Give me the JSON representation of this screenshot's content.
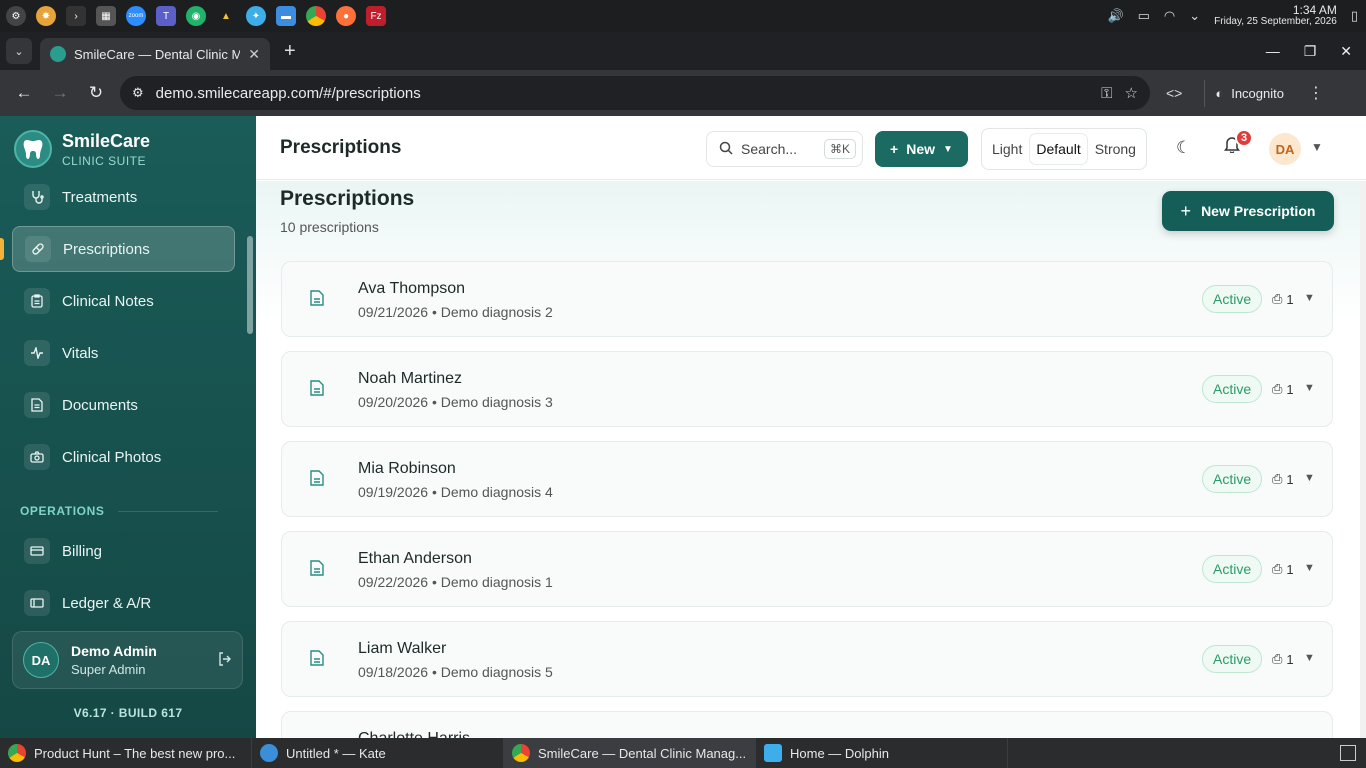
{
  "os": {
    "clock_time": "1:34 AM",
    "clock_date": "Friday, 25 September, 2026"
  },
  "browser": {
    "tab_title": "SmileCare — Dental Clinic M",
    "url": "demo.smilecareapp.com/#/prescriptions",
    "incognito_label": "Incognito"
  },
  "sidebar": {
    "brand_name": "SmileCare",
    "brand_sub": "CLINIC SUITE",
    "items": [
      {
        "label": "Treatments",
        "icon": "stethoscope-icon"
      },
      {
        "label": "Prescriptions",
        "icon": "pill-icon",
        "active": true
      },
      {
        "label": "Clinical Notes",
        "icon": "clipboard-icon"
      },
      {
        "label": "Vitals",
        "icon": "activity-icon"
      },
      {
        "label": "Documents",
        "icon": "document-icon"
      },
      {
        "label": "Clinical Photos",
        "icon": "camera-icon"
      }
    ],
    "section_operations": "OPERATIONS",
    "ops_items": [
      {
        "label": "Billing",
        "icon": "billing-icon"
      },
      {
        "label": "Ledger & A/R",
        "icon": "ledger-icon"
      }
    ],
    "user_initials": "DA",
    "user_name": "Demo Admin",
    "user_role": "Super Admin",
    "version": "V6.17 · BUILD 617"
  },
  "topbar": {
    "title": "Prescriptions",
    "search_placeholder": "Search...",
    "search_shortcut": "⌘K",
    "new_label": "New",
    "density": [
      "Light",
      "Default",
      "Strong"
    ],
    "density_selected": "Default",
    "notifications": "3",
    "avatar": "DA"
  },
  "page": {
    "heading": "Prescriptions",
    "count": "10 prescriptions",
    "new_button": "New Prescription"
  },
  "prescriptions": [
    {
      "patient": "Ava Thompson",
      "date": "09/21/2026",
      "diagnosis": "Demo diagnosis 2",
      "status": "Active",
      "copies": "1"
    },
    {
      "patient": "Noah Martinez",
      "date": "09/20/2026",
      "diagnosis": "Demo diagnosis 3",
      "status": "Active",
      "copies": "1"
    },
    {
      "patient": "Mia Robinson",
      "date": "09/19/2026",
      "diagnosis": "Demo diagnosis 4",
      "status": "Active",
      "copies": "1"
    },
    {
      "patient": "Ethan Anderson",
      "date": "09/22/2026",
      "diagnosis": "Demo diagnosis 1",
      "status": "Active",
      "copies": "1"
    },
    {
      "patient": "Liam Walker",
      "date": "09/18/2026",
      "diagnosis": "Demo diagnosis 5",
      "status": "Active",
      "copies": "1"
    },
    {
      "patient": "Charlotte Harris",
      "date": "",
      "diagnosis": "",
      "status": "",
      "copies": ""
    }
  ],
  "taskbar": [
    {
      "label": "Product Hunt – The best new pro...",
      "color": "#4285f4"
    },
    {
      "label": "Untitled * — Kate",
      "color": "#3a8fd8"
    },
    {
      "label": "SmileCare — Dental Clinic Manag...",
      "color": "#4285f4",
      "active": true
    },
    {
      "label": "Home — Dolphin",
      "color": "#3daee9"
    }
  ]
}
